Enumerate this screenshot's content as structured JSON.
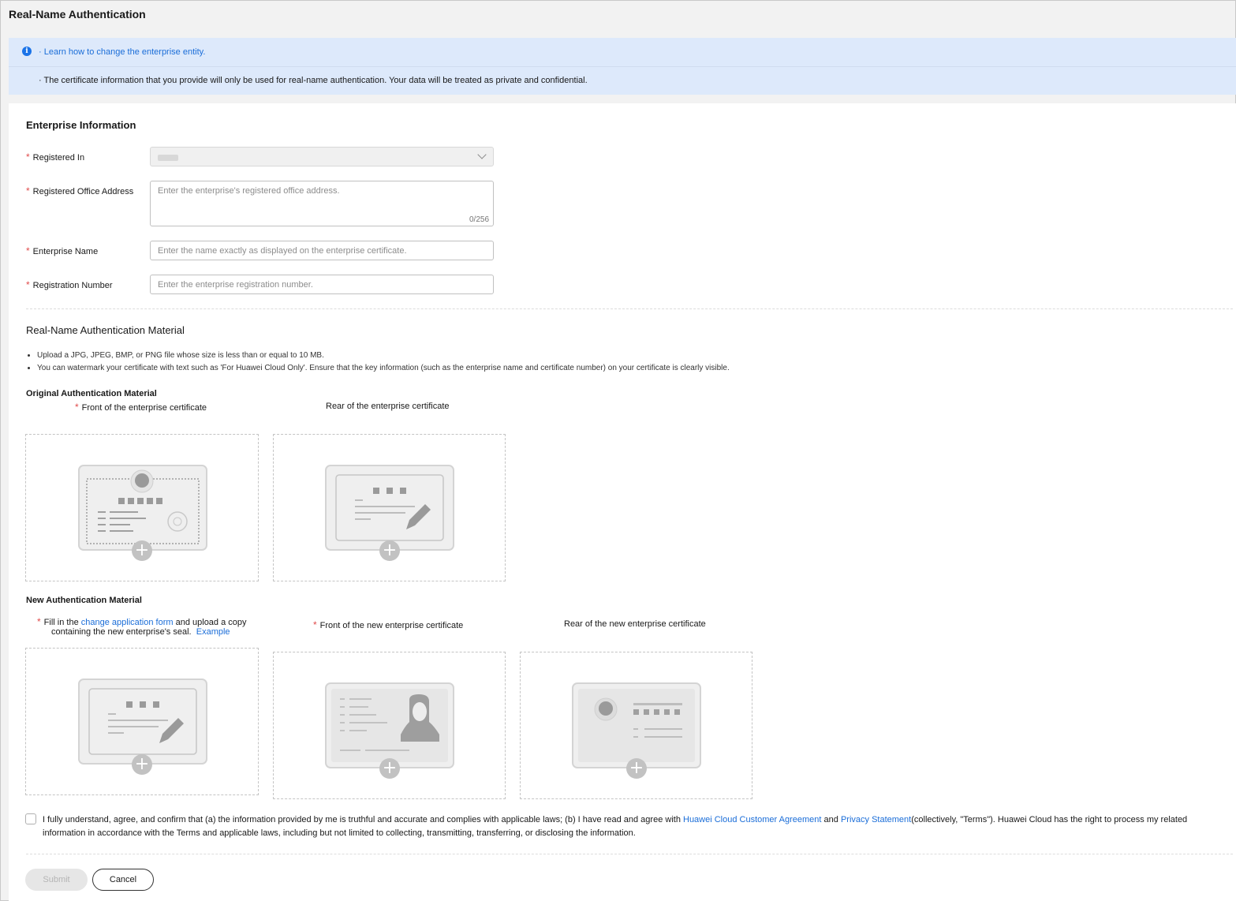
{
  "page_title": "Real-Name Authentication",
  "notice": {
    "link_text": "· Learn how to change the enterprise entity.",
    "text": "· The certificate information that you provide will only be used for real-name authentication. Your data will be treated as private and confidential."
  },
  "enterprise_info": {
    "title": "Enterprise Information",
    "registered_in": {
      "label": "Registered In",
      "value": ""
    },
    "address": {
      "label": "Registered Office Address",
      "placeholder": "Enter the enterprise's registered office address.",
      "counter": "0/256"
    },
    "name": {
      "label": "Enterprise Name",
      "placeholder": "Enter the name exactly as displayed on the enterprise certificate."
    },
    "reg_number": {
      "label": "Registration Number",
      "placeholder": "Enter the enterprise registration number."
    }
  },
  "material": {
    "title": "Real-Name Authentication Material",
    "bullets": [
      "Upload a JPG, JPEG, BMP, or PNG file whose size is less than or equal to 10 MB.",
      "You can watermark your certificate with text such as 'For Huawei Cloud Only'. Ensure that the key information (such as the enterprise name and certificate number) on your certificate is clearly visible."
    ],
    "original_title": "Original Authentication Material",
    "original_front": "Front of the enterprise certificate",
    "original_rear": "Rear of the enterprise certificate",
    "new_title": "New Authentication Material",
    "new_form_prefix": "Fill in the ",
    "new_form_link": "change application form",
    "new_form_suffix": " and upload a copy",
    "new_form_line2": "containing the new enterprise's seal.",
    "new_form_example": "Example",
    "new_front": "Front of the new enterprise certificate",
    "new_rear": "Rear of the new enterprise certificate"
  },
  "agreement": {
    "text1": "I fully understand, agree, and confirm that (a) the information provided by me is truthful and accurate and complies with applicable laws; (b) I have read and agree with ",
    "link1": "Huawei Cloud Customer Agreement",
    "and": " and ",
    "link2": "Privacy Statement",
    "text2": "(collectively, \"Terms\"). Huawei Cloud has the right to process my related information in accordance with the Terms and applicable laws, including but not limited to collecting, transmitting, transferring, or disclosing the information."
  },
  "buttons": {
    "submit": "Submit",
    "cancel": "Cancel"
  },
  "colors": {
    "link": "#1a6dd8",
    "required": "#e04b4b",
    "notice_bg": "#dde9fb",
    "info_icon": "#1a73e8"
  },
  "icons": {
    "info": "info-icon",
    "plus": "plus-icon",
    "chevron": "chevron-down-icon"
  }
}
